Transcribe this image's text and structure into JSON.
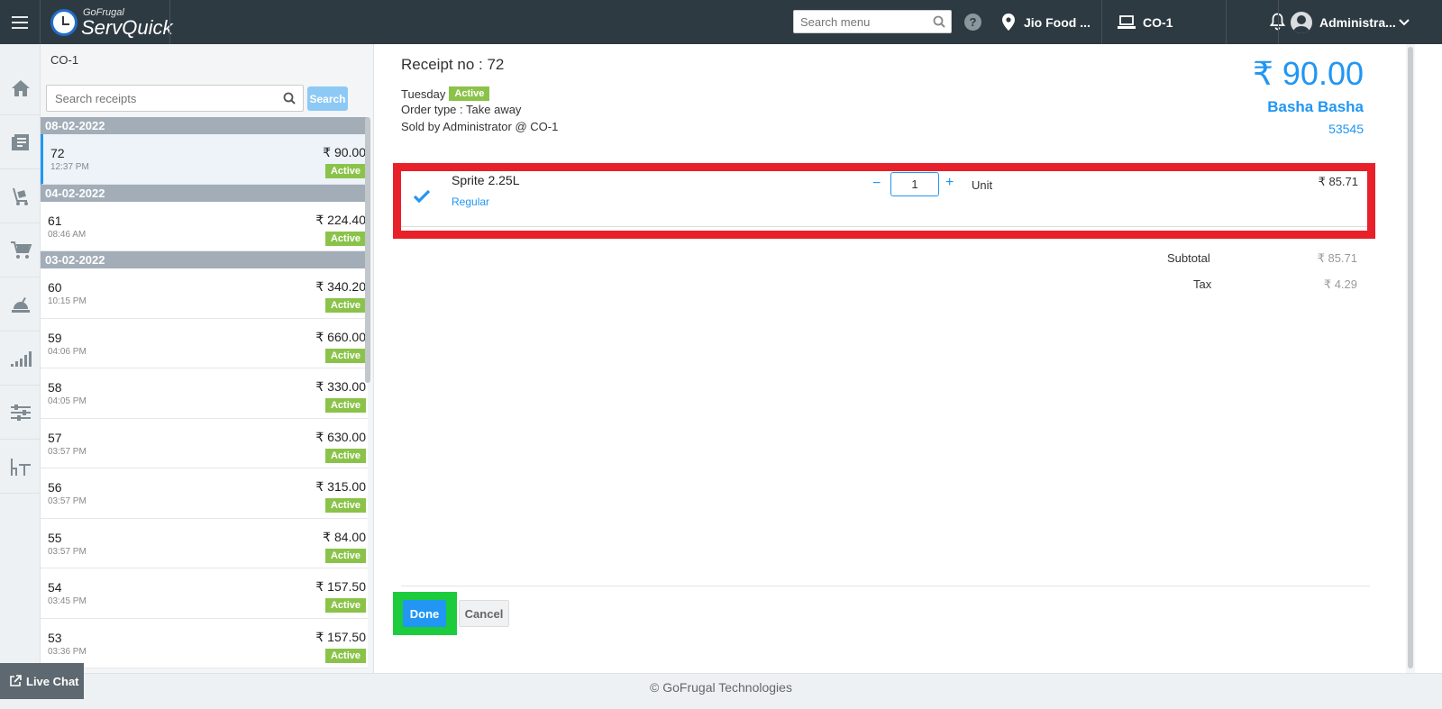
{
  "topbar": {
    "brand_sub": "GoFrugal",
    "brand_main": "ServQuick",
    "search_placeholder": "Search menu",
    "help": "?",
    "location": "Jio Food ...",
    "counter": "CO-1",
    "user": "Administra..."
  },
  "panel": {
    "title": "CO-1",
    "search_placeholder": "Search receipts",
    "search_button": "Search",
    "groups": [
      {
        "date": "08-02-2022",
        "receipts": [
          {
            "no": "72",
            "time": "12:37 PM",
            "amount": "₹ 90.00",
            "status": "Active"
          }
        ]
      },
      {
        "date": "04-02-2022",
        "receipts": [
          {
            "no": "61",
            "time": "08:46 AM",
            "amount": "₹ 224.40",
            "status": "Active"
          }
        ]
      },
      {
        "date": "03-02-2022",
        "receipts": [
          {
            "no": "60",
            "time": "10:15 PM",
            "amount": "₹ 340.20",
            "status": "Active"
          },
          {
            "no": "59",
            "time": "04:06 PM",
            "amount": "₹ 660.00",
            "status": "Active"
          },
          {
            "no": "58",
            "time": "04:05 PM",
            "amount": "₹ 330.00",
            "status": "Active"
          },
          {
            "no": "57",
            "time": "03:57 PM",
            "amount": "₹ 630.00",
            "status": "Active"
          },
          {
            "no": "56",
            "time": "03:57 PM",
            "amount": "₹ 315.00",
            "status": "Active"
          },
          {
            "no": "55",
            "time": "03:57 PM",
            "amount": "₹ 84.00",
            "status": "Active"
          },
          {
            "no": "54",
            "time": "03:45 PM",
            "amount": "₹ 157.50",
            "status": "Active"
          },
          {
            "no": "53",
            "time": "03:36 PM",
            "amount": "₹ 157.50",
            "status": "Active"
          }
        ]
      }
    ]
  },
  "receipt": {
    "title": "Receipt no : 72",
    "day": "Tuesday",
    "status": "Active",
    "order_type": "Order type : Take away",
    "sold_by": "Sold by Administrator @ CO-1",
    "total": "₹ 90.00",
    "customer": "Basha Basha",
    "customer_id": "53545",
    "item": {
      "name": "Sprite 2.25L",
      "variant": "Regular",
      "qty": "1",
      "minus": "−",
      "plus": "+",
      "unit": "Unit",
      "price": "₹ 85.71"
    },
    "subtotal_label": "Subtotal",
    "subtotal": "₹ 85.71",
    "tax_label": "Tax",
    "tax": "₹ 4.29",
    "done": "Done",
    "cancel": "Cancel"
  },
  "footer": {
    "copyright": "© GoFrugal Technologies",
    "live_chat": "Live Chat"
  },
  "colors": {
    "accent": "#2196f3",
    "status_active": "#8bc34a",
    "highlight_red": "#e8202a",
    "highlight_green": "#1ccc3d",
    "topbar": "#2e3a42"
  }
}
